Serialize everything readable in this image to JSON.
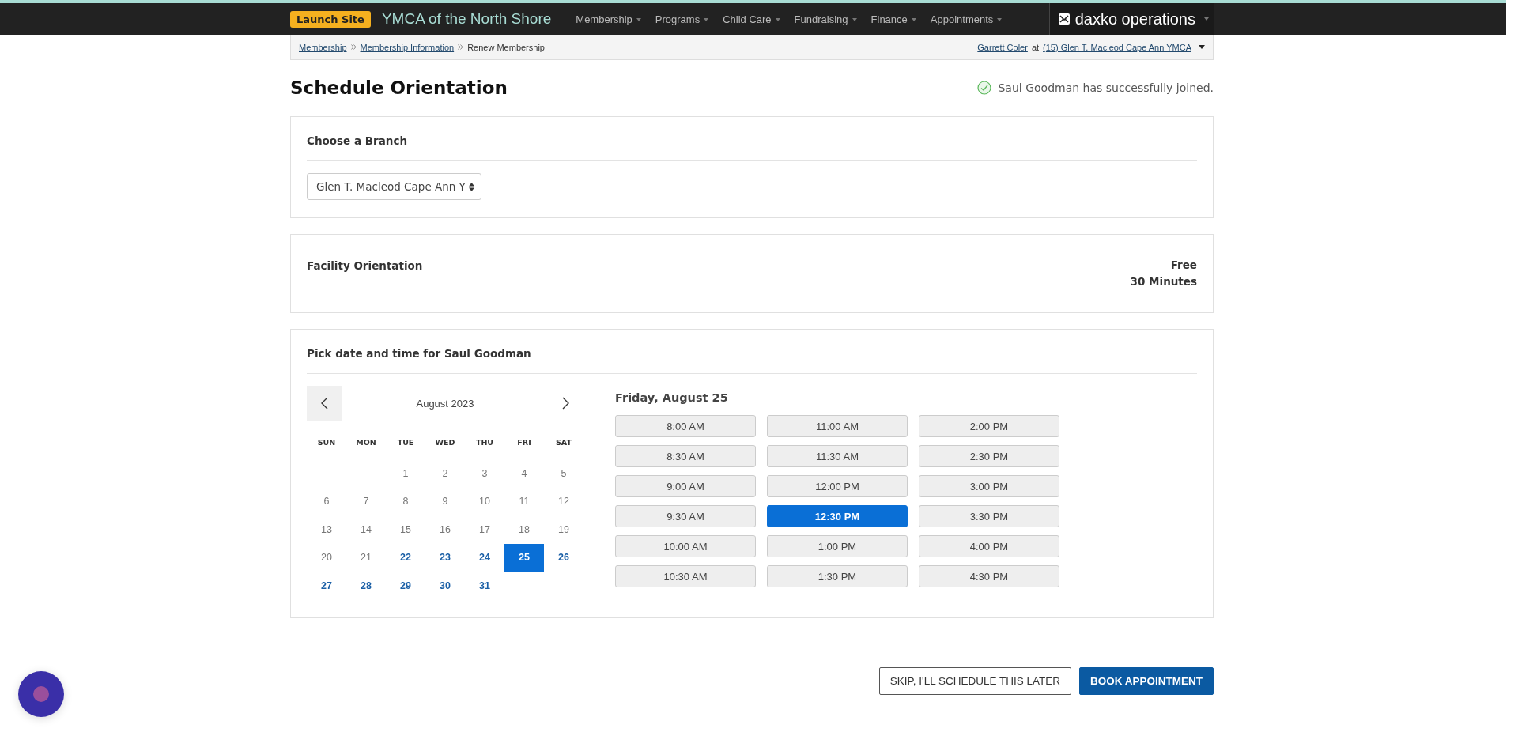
{
  "topbar": {
    "launch_button": "Launch Site",
    "org_name": "YMCA of the North Shore",
    "menu": [
      "Membership",
      "Programs",
      "Child Care",
      "Fundraising",
      "Finance",
      "Appointments"
    ],
    "product_logo": "daxko operations"
  },
  "breadcrumb": {
    "links": [
      "Membership",
      "Membership Information"
    ],
    "current": "Renew Membership",
    "user": "Garrett Coler",
    "at": "at",
    "location": "(15) Glen T. Macleod Cape Ann YMCA"
  },
  "page_title": "Schedule Orientation",
  "success_message": "Saul Goodman has successfully joined.",
  "branch": {
    "heading": "Choose a Branch",
    "value": "Glen T. Macleod Cape Ann Y"
  },
  "service": {
    "name": "Facility Orientation",
    "price": "Free",
    "duration": "30 Minutes"
  },
  "picker": {
    "heading": "Pick date and time for Saul Goodman",
    "month": "August 2023",
    "weekdays": [
      "SUN",
      "MON",
      "TUE",
      "WED",
      "THU",
      "FRI",
      "SAT"
    ],
    "weeks": [
      [
        {
          "label": "1",
          "available": false,
          "selected": false
        },
        {
          "label": "2",
          "available": false,
          "selected": false
        },
        {
          "label": "3",
          "available": false,
          "selected": false
        },
        {
          "label": "4",
          "available": false,
          "selected": false
        },
        {
          "label": "5",
          "available": false,
          "selected": false
        }
      ],
      [
        {
          "label": "6",
          "available": false,
          "selected": false
        },
        {
          "label": "7",
          "available": false,
          "selected": false
        },
        {
          "label": "8",
          "available": false,
          "selected": false
        },
        {
          "label": "9",
          "available": false,
          "selected": false
        },
        {
          "label": "10",
          "available": false,
          "selected": false
        },
        {
          "label": "11",
          "available": false,
          "selected": false
        },
        {
          "label": "12",
          "available": false,
          "selected": false
        }
      ],
      [
        {
          "label": "13",
          "available": false,
          "selected": false
        },
        {
          "label": "14",
          "available": false,
          "selected": false
        },
        {
          "label": "15",
          "available": false,
          "selected": false
        },
        {
          "label": "16",
          "available": false,
          "selected": false
        },
        {
          "label": "17",
          "available": false,
          "selected": false
        },
        {
          "label": "18",
          "available": false,
          "selected": false
        },
        {
          "label": "19",
          "available": false,
          "selected": false
        }
      ],
      [
        {
          "label": "20",
          "available": false,
          "selected": false
        },
        {
          "label": "21",
          "available": false,
          "selected": false
        },
        {
          "label": "22",
          "available": true,
          "selected": false
        },
        {
          "label": "23",
          "available": true,
          "selected": false
        },
        {
          "label": "24",
          "available": true,
          "selected": false
        },
        {
          "label": "25",
          "available": true,
          "selected": true
        },
        {
          "label": "26",
          "available": true,
          "selected": false
        }
      ],
      [
        {
          "label": "27",
          "available": true,
          "selected": false
        },
        {
          "label": "28",
          "available": true,
          "selected": false
        },
        {
          "label": "29",
          "available": true,
          "selected": false
        },
        {
          "label": "30",
          "available": true,
          "selected": false
        },
        {
          "label": "31",
          "available": true,
          "selected": false
        }
      ]
    ],
    "day_heading": "Friday, August 25",
    "slot_columns": [
      [
        {
          "label": "8:00 AM",
          "selected": false
        },
        {
          "label": "8:30 AM",
          "selected": false
        },
        {
          "label": "9:00 AM",
          "selected": false
        },
        {
          "label": "9:30 AM",
          "selected": false
        },
        {
          "label": "10:00 AM",
          "selected": false
        },
        {
          "label": "10:30 AM",
          "selected": false
        }
      ],
      [
        {
          "label": "11:00 AM",
          "selected": false
        },
        {
          "label": "11:30 AM",
          "selected": false
        },
        {
          "label": "12:00 PM",
          "selected": false
        },
        {
          "label": "12:30 PM",
          "selected": true
        },
        {
          "label": "1:00 PM",
          "selected": false
        },
        {
          "label": "1:30 PM",
          "selected": false
        }
      ],
      [
        {
          "label": "2:00 PM",
          "selected": false
        },
        {
          "label": "2:30 PM",
          "selected": false
        },
        {
          "label": "3:00 PM",
          "selected": false
        },
        {
          "label": "3:30 PM",
          "selected": false
        },
        {
          "label": "4:00 PM",
          "selected": false
        },
        {
          "label": "4:30 PM",
          "selected": false
        }
      ]
    ]
  },
  "actions": {
    "skip": "SKIP, I'LL SCHEDULE THIS LATER",
    "book": "BOOK APPOINTMENT"
  }
}
